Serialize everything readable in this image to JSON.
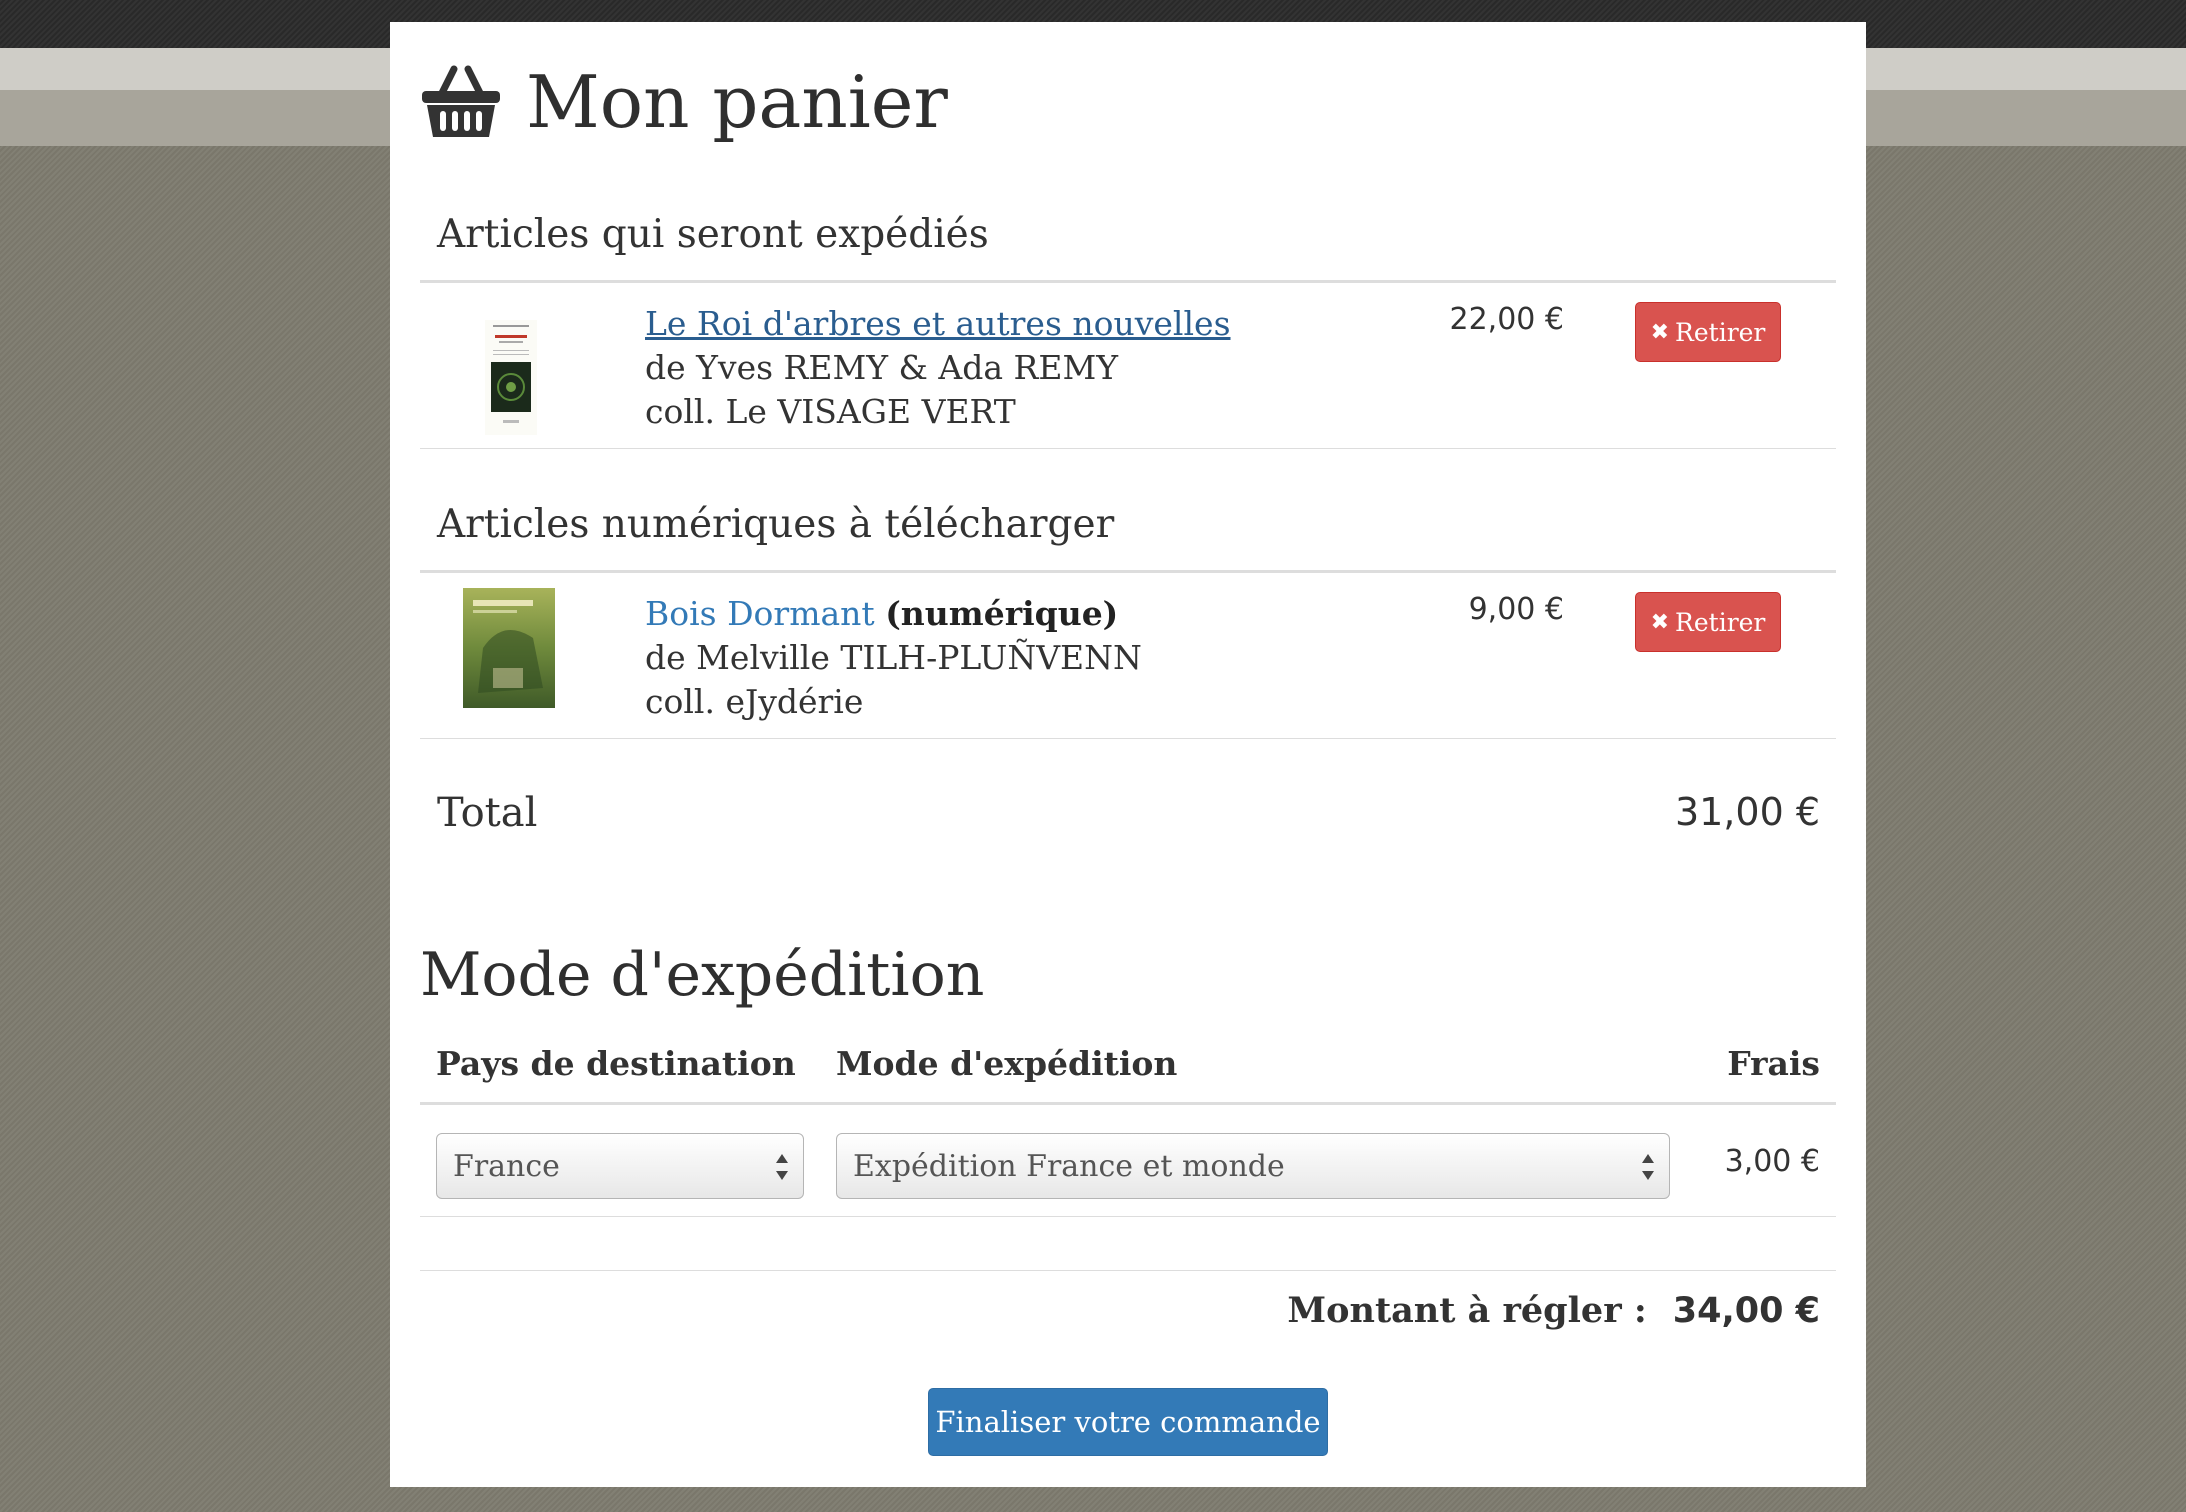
{
  "page": {
    "title": "Mon panier",
    "basket_icon": "shopping-basket-icon"
  },
  "shipped": {
    "title": "Articles qui seront expédiés",
    "items": [
      {
        "title": "Le Roi d'arbres et autres nouvelles",
        "author": "de Yves REMY & Ada REMY",
        "collection": "coll. Le VISAGE VERT",
        "price": "22,00 €"
      }
    ]
  },
  "digital": {
    "title": "Articles numériques à télécharger",
    "items": [
      {
        "title": "Bois Dormant",
        "format": "(numérique)",
        "author": "de Melville TILH-PLUÑVENN",
        "collection": "coll. eJydérie",
        "price": "9,00 €"
      }
    ]
  },
  "remove_label": "Retirer",
  "total": {
    "label": "Total",
    "value": "31,00 €"
  },
  "shipping": {
    "title": "Mode d'expédition",
    "headers": {
      "country": "Pays de destination",
      "mode": "Mode d'expédition",
      "fees": "Frais"
    },
    "country_selected": "France",
    "mode_selected": "Expédition France et monde",
    "fees": "3,00 €"
  },
  "amount": {
    "label": "Montant à régler :",
    "value": "34,00 €"
  },
  "checkout_label": "Finaliser votre commande",
  "colors": {
    "danger": "#d9534f",
    "primary": "#337ab7",
    "link": "#337ab7"
  }
}
